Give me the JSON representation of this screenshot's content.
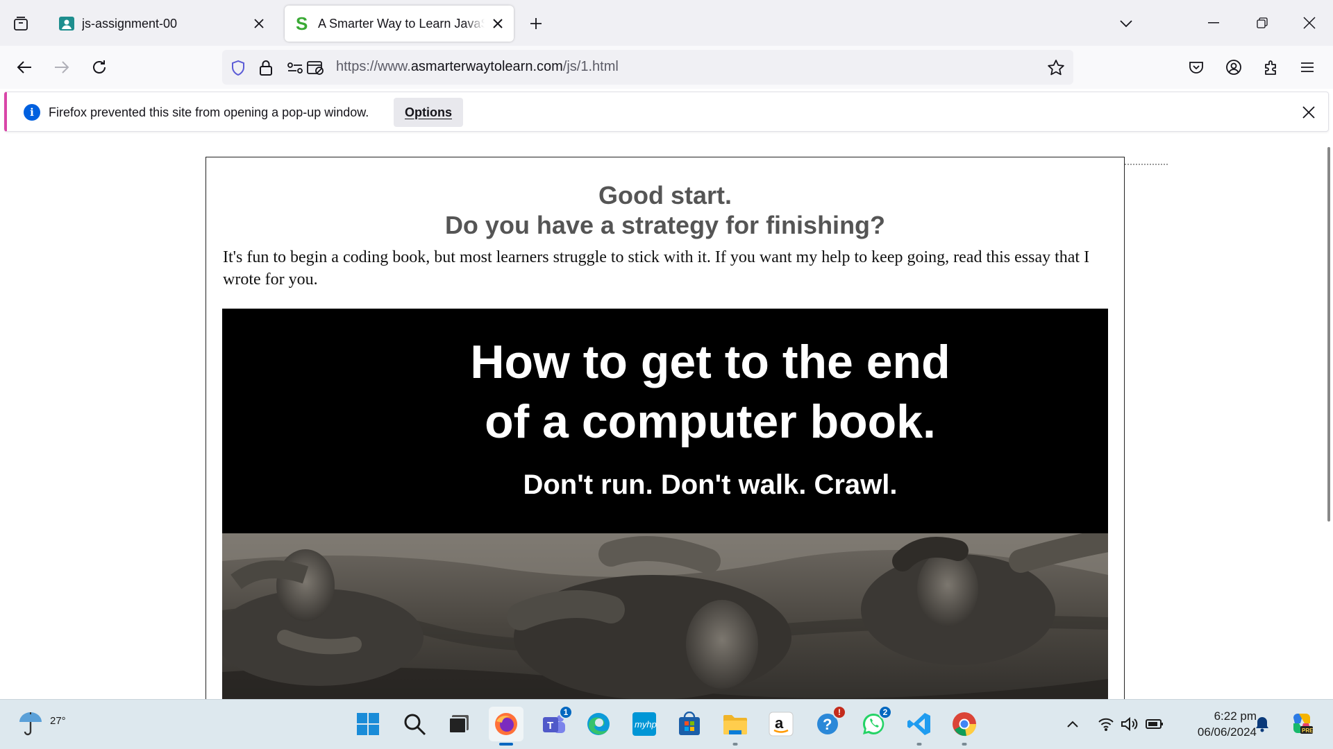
{
  "browser": {
    "tabs": [
      {
        "title": "js-assignment-00",
        "icon": "classroom-favicon-icon",
        "active": false
      },
      {
        "title": "A Smarter Way to Learn JavaScript",
        "icon": "s-favicon-icon",
        "active": true
      }
    ],
    "url": {
      "prefix": "https://www.",
      "domain": "asmarterwaytolearn.com",
      "path": "/js/1.html"
    },
    "notification": {
      "message": "Firefox prevented this site from opening a pop-up window.",
      "button": "Options"
    }
  },
  "page": {
    "heading_line1": "Good start.",
    "heading_line2": "Do you have a strategy for finishing?",
    "paragraph": "It's fun to begin a coding book, but most learners struggle to stick with it. If you want my help to keep going, read this essay that I wrote for you.",
    "promo": {
      "line1": "How to get to the end",
      "line2": "of a computer book.",
      "line3": "Don't run. Don't walk. Crawl."
    }
  },
  "taskbar": {
    "weather_temp": "27°",
    "apps": [
      {
        "name": "start",
        "icon": "windows-start-icon"
      },
      {
        "name": "search",
        "icon": "search-icon"
      },
      {
        "name": "task-view",
        "icon": "task-view-icon"
      },
      {
        "name": "firefox",
        "icon": "firefox-icon"
      },
      {
        "name": "teams",
        "icon": "teams-icon",
        "badge": "1"
      },
      {
        "name": "edge",
        "icon": "edge-icon"
      },
      {
        "name": "myhp",
        "icon": "myhp-icon"
      },
      {
        "name": "store",
        "icon": "microsoft-store-icon"
      },
      {
        "name": "file-explorer",
        "icon": "folder-icon"
      },
      {
        "name": "amazon",
        "icon": "amazon-icon"
      },
      {
        "name": "get-help",
        "icon": "help-icon",
        "badge": "!"
      },
      {
        "name": "whatsapp",
        "icon": "whatsapp-icon",
        "badge": "2"
      },
      {
        "name": "vscode",
        "icon": "vscode-icon"
      },
      {
        "name": "chrome",
        "icon": "chrome-icon"
      }
    ],
    "time": "6:22 pm",
    "date": "06/06/2024"
  },
  "colors": {
    "tabstrip": "#f0f0f4",
    "accent": "#0060df",
    "taskbar": "#dde8ee"
  }
}
